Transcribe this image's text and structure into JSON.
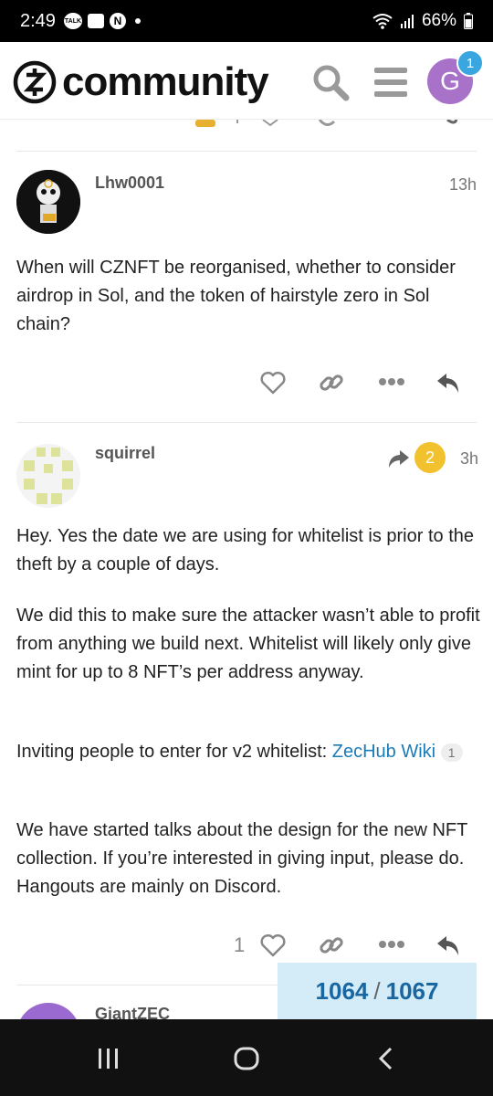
{
  "status_bar": {
    "time": "2:49",
    "talk_label": "TALK",
    "n_label": "N",
    "battery": "66%"
  },
  "header": {
    "logo_text": "community",
    "notification_count": "1",
    "avatar_letter": "G"
  },
  "posts": [
    {
      "username": "Lhw0001",
      "time": "13h",
      "body": "When will CZNFT be reorganised, whether to consider airdrop in Sol, and the token of hairstyle zero in Sol chain?"
    },
    {
      "username": "squirrel",
      "reply_count": "2",
      "time": "3h",
      "paragraphs": [
        "Hey. Yes the date we are using for whitelist is prior to the theft by a couple of days.",
        "We did this to make sure the attacker wasn’t able to profit from anything we build next. Whitelist will likely only give mint for up to 8 NFT’s per address anyway."
      ],
      "p3_prefix": "Inviting people to enter for v2 whitelist: ",
      "p3_link": "ZecHub Wiki",
      "p3_link_count": "1",
      "p4": "We have started talks about the design for the new NFT collection. If you’re interested in giving input, please do. Hangouts are mainly on Discord.",
      "like_count": "1"
    }
  ],
  "next_post": {
    "username": "GiantZEC"
  },
  "progress": {
    "current": "1064",
    "separator": "/",
    "total": "1067"
  },
  "colors": {
    "accent": "#1a7bb8",
    "badge_yellow": "#f2c12e",
    "avatar_purple": "#a972c9",
    "progress_bg": "#d4ecf8"
  }
}
